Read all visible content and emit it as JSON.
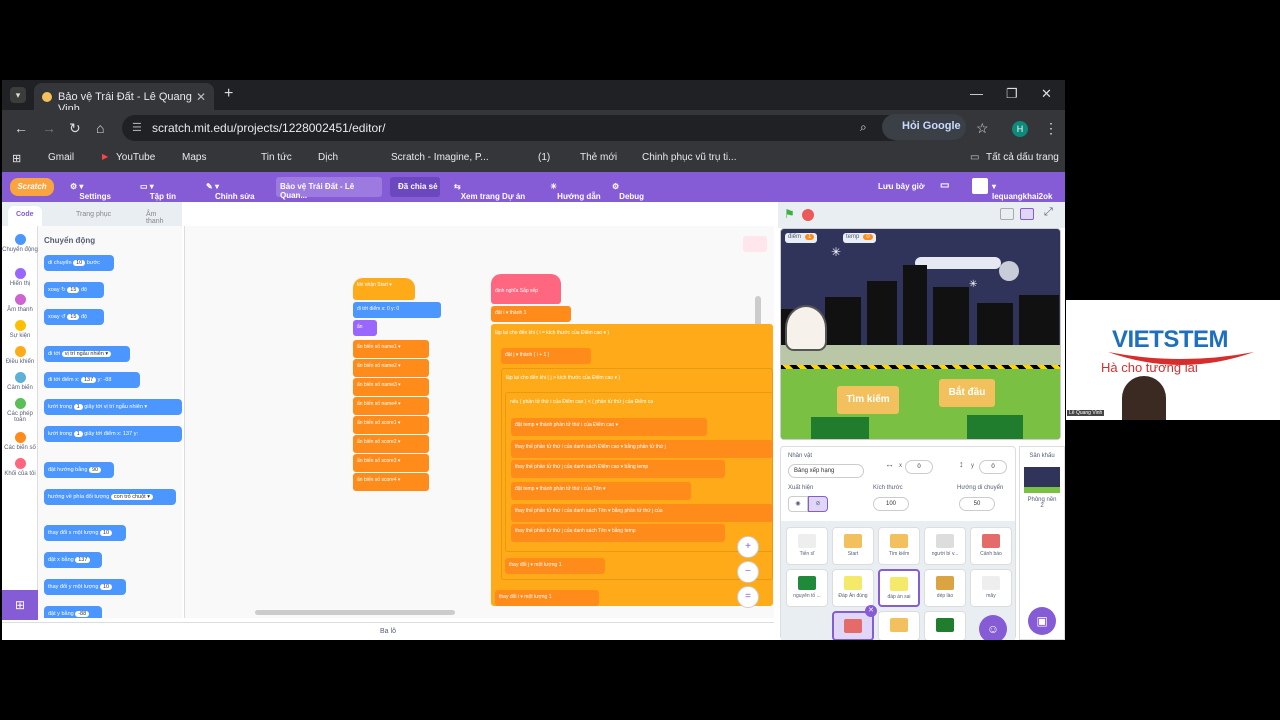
{
  "browser": {
    "tab_title": "Bảo vệ Trái Đất - Lê Quang Vinh",
    "url": "scratch.mit.edu/projects/1228002451/editor/",
    "google_button": "Hỏi Google",
    "profile_initial": "H",
    "bookmarks": [
      "Gmail",
      "YouTube",
      "Maps",
      "Tin tức",
      "Dịch",
      "Scratch - Imagine, P...",
      "(1)",
      "Thẻ mới",
      "Chinh phục vũ trụ ti...",
      "Tất cả dấu trang"
    ]
  },
  "menu": {
    "settings": "Settings",
    "file": "Tập tin",
    "edit": "Chỉnh sửa",
    "project_title": "Bảo vệ Trái Đất - Lê Quan...",
    "shared": "Đã chia sẻ",
    "project_page": "Xem trang Dự án",
    "tutorials": "Hướng dẫn",
    "debug": "Debug",
    "save_now": "Lưu bây giờ",
    "username": "lequangkhai2ok"
  },
  "editor_tabs": [
    "Code",
    "Trang phục",
    "Âm thanh"
  ],
  "categories": [
    {
      "label": "Chuyển động",
      "color": "#4c97ff"
    },
    {
      "label": "Hiển thị",
      "color": "#9966ff"
    },
    {
      "label": "Âm thanh",
      "color": "#cf63cf"
    },
    {
      "label": "Sự kiện",
      "color": "#ffbf00"
    },
    {
      "label": "Điều khiển",
      "color": "#ffab19"
    },
    {
      "label": "Cảm biến",
      "color": "#5cb1d6"
    },
    {
      "label": "Các phép toán",
      "color": "#59c059"
    },
    {
      "label": "Các biến số",
      "color": "#ff8c1a"
    },
    {
      "label": "Khối của tôi",
      "color": "#ff6680"
    }
  ],
  "palette": {
    "heading": "Chuyển động",
    "blocks": [
      {
        "text": "di chuyển",
        "val": "10",
        "suffix": "bước"
      },
      {
        "text": "xoay ↻",
        "val": "15",
        "suffix": "độ"
      },
      {
        "text": "xoay ↺",
        "val": "15",
        "suffix": "độ"
      },
      {
        "text": "đi tới",
        "val": "vị trí ngẫu nhiên ▾",
        "suffix": ""
      },
      {
        "text": "đi tới điểm x:",
        "val": "137",
        "suffix": "y: -88"
      },
      {
        "text": "lướt trong",
        "val": "1",
        "suffix": "giây tới vị trí ngẫu nhiên ▾"
      },
      {
        "text": "lướt trong",
        "val": "1",
        "suffix": "giây tới điểm x: 137 y:"
      },
      {
        "text": "đặt hướng bằng",
        "val": "90",
        "suffix": ""
      },
      {
        "text": "hướng về phía đối tượng",
        "val": "con trỏ chuột ▾",
        "suffix": ""
      },
      {
        "text": "thay đổi x một lượng",
        "val": "10",
        "suffix": ""
      },
      {
        "text": "đặt x bằng",
        "val": "137",
        "suffix": ""
      },
      {
        "text": "thay đổi y một lượng",
        "val": "10",
        "suffix": ""
      },
      {
        "text": "đặt y bằng",
        "val": "-88",
        "suffix": ""
      }
    ]
  },
  "script1": {
    "hat": "khi nhận Start ▾",
    "goto": "đi tới điểm x: 0 y: 0",
    "hide": "ẩn",
    "vars": [
      "ẩn biến số name1 ▾",
      "ẩn biến số name2 ▾",
      "ẩn biến số name3 ▾",
      "ẩn biến số name4 ▾",
      "ẩn biến số score1 ▾",
      "ẩn biến số score2 ▾",
      "ẩn biến số score3 ▾",
      "ẩn biến số score4 ▾"
    ]
  },
  "script2": {
    "define": "định nghĩa Sắp xếp",
    "lines": [
      "đặt i ▾ thành 1",
      "lặp lại cho đến khi ( i = kích thước của Điểm cao ▾ )",
      "đặt j ▾ thành ( i + 1 )",
      "lặp lại cho đến khi ( j > kích thước của Điểm cao ▾ )",
      "nếu ( phần tử thứ i của Điểm cao ) < ( phần tử thứ j của Điểm ca",
      "đặt temp ▾ thành phần tử thứ i của Điểm cao ▾",
      "thay thế phần tử thứ i của danh sách Điểm cao ▾ bằng phần tử thứ j",
      "thay thế phần tử thứ j của danh sách Điểm cao ▾ bằng temp",
      "đặt temp ▾ thành phần tử thứ i của Tên ▾",
      "thay thế phần tử thứ i của danh sách Tên ▾ bằng phần tử thứ j của",
      "thay thế phần tử thứ j của danh sách Tên ▾ bằng temp",
      "thay đổi j ▾ một lượng 1",
      "thay đổi i ▾ một lượng 1"
    ]
  },
  "zoom": {
    "in": "+",
    "out": "−",
    "reset": "="
  },
  "backpack": "Ba lô",
  "stage": {
    "var1_name": "điểm",
    "var1_value": "1",
    "var2_name": "temp",
    "var2_value": "0",
    "search_button": "Tìm kiếm",
    "start_button": "Bắt đầu"
  },
  "sprite_info": {
    "label": "Nhân vật",
    "name": "Bảng xếp hạng",
    "x_label": "x",
    "x": "0",
    "y_label": "y",
    "y": "0",
    "show_label": "Xuất hiện",
    "size_label": "Kích thước",
    "size": "100",
    "direction_label": "Hướng di chuyển",
    "direction": "50"
  },
  "sprites": [
    {
      "name": "Tiến sĩ",
      "color": "#eeeeee"
    },
    {
      "name": "Start",
      "color": "#f2c15d"
    },
    {
      "name": "Tìm kiếm",
      "color": "#f2c15d"
    },
    {
      "name": "người bí v...",
      "color": "#dddddd"
    },
    {
      "name": "Cảnh báo",
      "color": "#e56a6a"
    },
    {
      "name": "nguyên tố ...",
      "color": "#1f8a3a"
    },
    {
      "name": "Đáp Án đúng",
      "color": "#f5e96a"
    },
    {
      "name": "đáp án sai",
      "color": "#f5e96a"
    },
    {
      "name": "dép lào",
      "color": "#d9a441"
    },
    {
      "name": "mây",
      "color": "#eeeeee"
    }
  ],
  "backdrop": {
    "label": "Sân khấu",
    "sub": "Phông nền",
    "count": "2"
  },
  "webcam": {
    "brand": "VIETSTEM",
    "slogan": "Hà    cho tương lai",
    "name": "Lê Quang Vinh"
  }
}
